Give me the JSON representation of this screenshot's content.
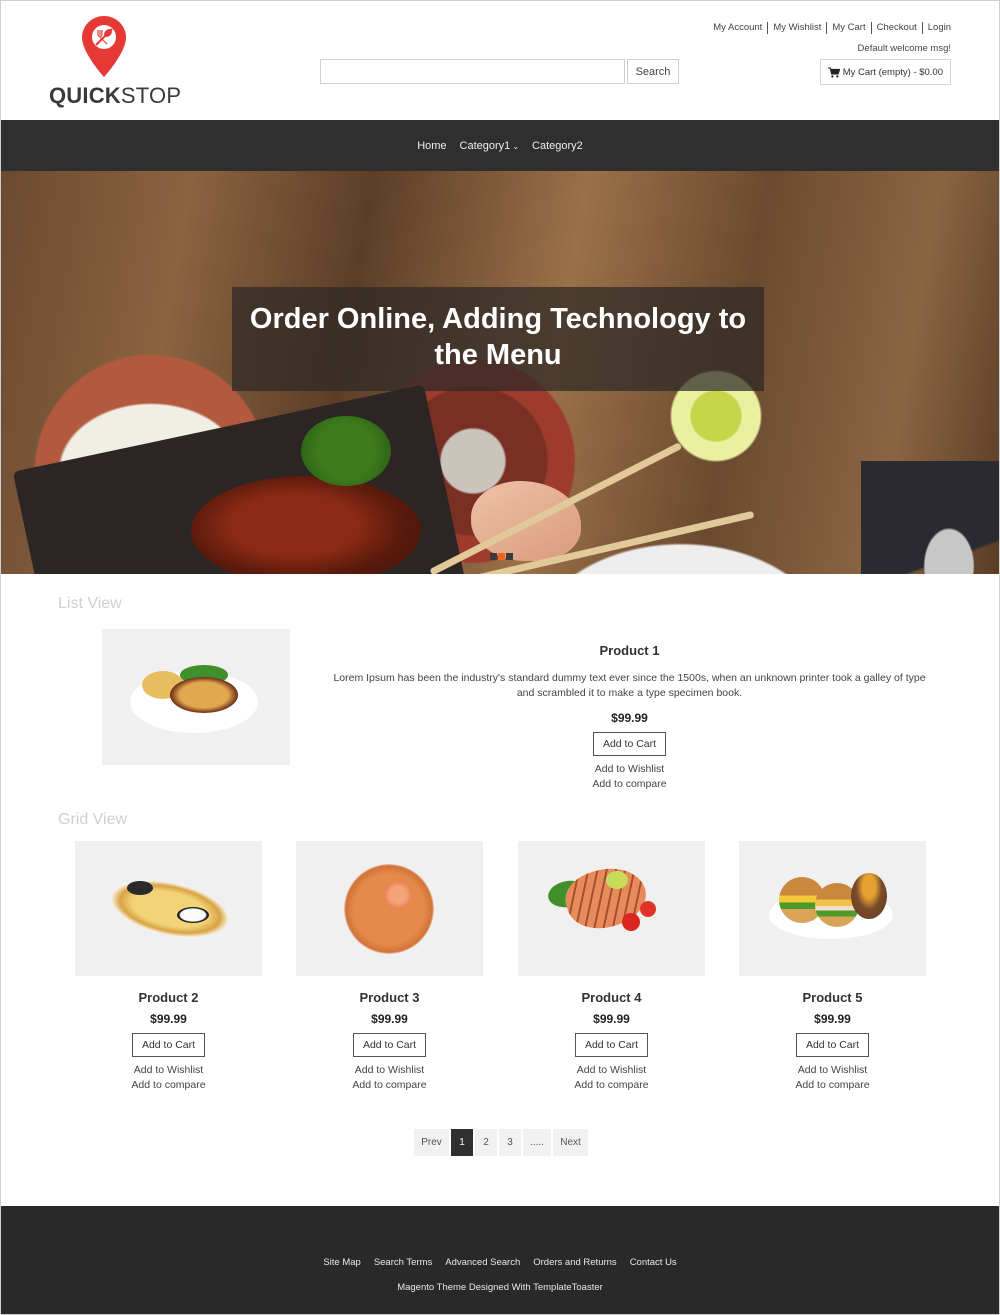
{
  "header": {
    "logo": {
      "bold": "QUICK",
      "light": "STOP",
      "brand_color": "#e53935"
    },
    "search": {
      "placeholder": "",
      "value": "",
      "button_label": "Search"
    },
    "top_links": [
      "My Account",
      "My Wishlist",
      "My Cart",
      "Checkout",
      "Login"
    ],
    "welcome_msg": "Default welcome msg!",
    "mini_cart": {
      "icon": "cart-icon",
      "label": "My Cart (empty) - $0.00"
    }
  },
  "nav": {
    "items": [
      {
        "label": "Home",
        "has_dropdown": false
      },
      {
        "label": "Category1",
        "has_dropdown": true
      },
      {
        "label": "Category2",
        "has_dropdown": false
      }
    ],
    "dropdown_glyph": "⌵"
  },
  "hero": {
    "caption": "Order Online, Adding Technology to the Menu",
    "slides": 3,
    "active_slide": 2,
    "accent_color": "#f0641e"
  },
  "list_view": {
    "title": "List View",
    "product": {
      "name": "Product 1",
      "description": "Lorem Ipsum has been the industry's standard dummy text ever since the 1500s, when an unknown printer took a galley of type and scrambled it to make a type specimen book.",
      "price": "$99.99",
      "add_to_cart": "Add to Cart",
      "add_to_wishlist": "Add to Wishlist",
      "add_to_compare": "Add to compare"
    }
  },
  "grid_view": {
    "title": "Grid View",
    "products": [
      {
        "name": "Product 2",
        "price": "$99.99",
        "add_to_cart": "Add to Cart",
        "add_to_wishlist": "Add to Wishlist",
        "add_to_compare": "Add to compare"
      },
      {
        "name": "Product 3",
        "price": "$99.99",
        "add_to_cart": "Add to Cart",
        "add_to_wishlist": "Add to Wishlist",
        "add_to_compare": "Add to compare"
      },
      {
        "name": "Product 4",
        "price": "$99.99",
        "add_to_cart": "Add to Cart",
        "add_to_wishlist": "Add to Wishlist",
        "add_to_compare": "Add to compare"
      },
      {
        "name": "Product 5",
        "price": "$99.99",
        "add_to_cart": "Add to Cart",
        "add_to_wishlist": "Add to Wishlist",
        "add_to_compare": "Add to compare"
      }
    ]
  },
  "pagination": {
    "prev": "Prev",
    "pages": [
      "1",
      "2",
      "3",
      "....."
    ],
    "current": "1",
    "next": "Next"
  },
  "footer": {
    "links": [
      "Site Map",
      "Search Terms",
      "Advanced Search",
      "Orders and Returns",
      "Contact Us"
    ],
    "credit": "Magento Theme Designed With TemplateToaster"
  }
}
